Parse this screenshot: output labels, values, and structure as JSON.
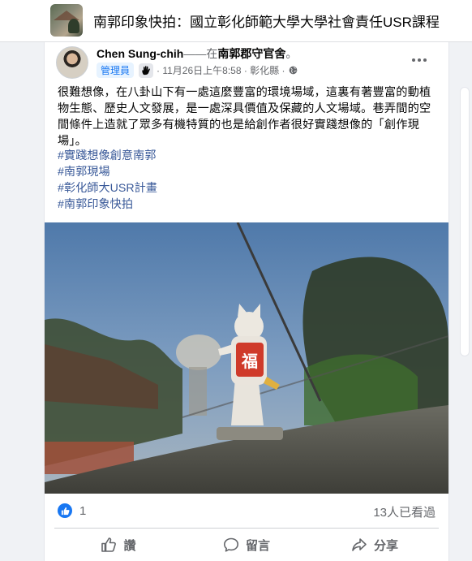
{
  "group": {
    "title": "南郭印象快拍：國立彰化師範大學大學社會責任USR課程"
  },
  "post": {
    "author": "Chen Sung-chih",
    "in_text": "——在",
    "place": "南郭郡守官舍",
    "place_suffix": "。",
    "role_badge": "管理員",
    "timestamp": "· 11月26日上午8:58 · 彰化縣 ·",
    "text": "很難想像，在八卦山下有一處這麼豐富的環境場域，這裏有著豐富的動植物生態、歷史人文發展，是一處深具價值及保藏的人文場域。巷弄間的空間條件上造就了眾多有機特質的也是給創作者很好實踐想像的「創作現場」。",
    "hashtags": [
      "#實踐想像創意南郭",
      "#南郭現場",
      "#彰化師大USR計畫",
      "#南郭印象快拍"
    ],
    "photo": {
      "sign_text": "福"
    },
    "reaction_count": "1",
    "views": "13人已看過"
  },
  "actions": {
    "like": "讚",
    "comment": "留言",
    "share": "分享"
  },
  "colors": {
    "accent": "#1877f2",
    "hashtag": "#385898",
    "muted": "#65676b"
  }
}
